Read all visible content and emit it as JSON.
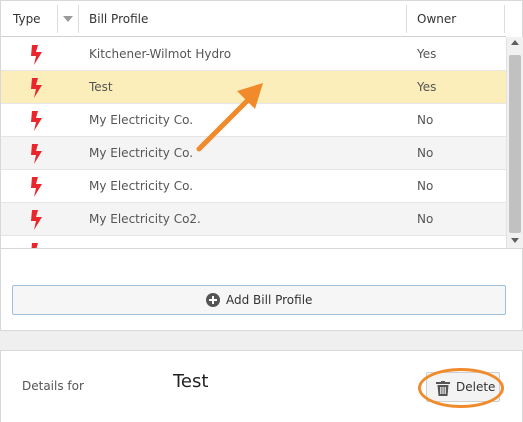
{
  "grid": {
    "headers": {
      "type": "Type",
      "bill_profile": "Bill Profile",
      "owner": "Owner"
    },
    "rows": [
      {
        "bill_profile": "Kitchener-Wilmot Hydro",
        "owner": "Yes",
        "icon": "lightning-icon",
        "state": "normal"
      },
      {
        "bill_profile": "Test",
        "owner": "Yes",
        "icon": "lightning-icon",
        "state": "selected"
      },
      {
        "bill_profile": "My Electricity Co.",
        "owner": "No",
        "icon": "lightning-icon",
        "state": "normal"
      },
      {
        "bill_profile": "My Electricity Co.",
        "owner": "No",
        "icon": "lightning-icon",
        "state": "alt"
      },
      {
        "bill_profile": "My Electricity Co.",
        "owner": "No",
        "icon": "lightning-icon",
        "state": "normal"
      },
      {
        "bill_profile": "My Electricity Co2.",
        "owner": "No",
        "icon": "lightning-icon",
        "state": "alt"
      },
      {
        "bill_profile": "",
        "owner": "",
        "icon": "lightning-icon",
        "state": "normal"
      }
    ]
  },
  "add_button": {
    "label": "Add Bill Profile",
    "icon": "plus-circle-icon"
  },
  "details": {
    "label": "Details for",
    "name": "Test",
    "delete_label": "Delete",
    "delete_icon": "trash-icon"
  },
  "colors": {
    "selected_row": "#fbeeba",
    "alt_row": "#f4f4f4",
    "lightning": "#e8262b",
    "annotation": "#f08a2a",
    "add_border": "#9fbedc"
  }
}
